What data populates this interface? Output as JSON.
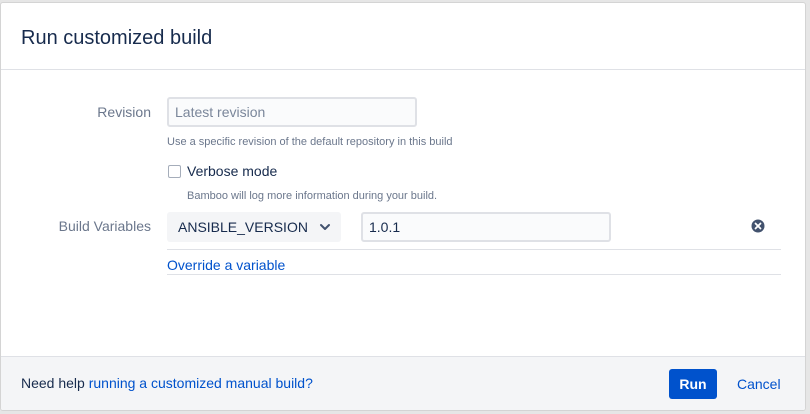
{
  "dialog": {
    "title": "Run customized build"
  },
  "revision": {
    "label": "Revision",
    "placeholder": "Latest revision",
    "help": "Use a specific revision of the default repository in this build"
  },
  "verbose": {
    "label": "Verbose mode",
    "checked": false,
    "help": "Bamboo will log more information during your build."
  },
  "build_variables": {
    "label": "Build Variables",
    "variable_name": "ANSIBLE_VERSION",
    "variable_value": "1.0.1",
    "override_link": "Override a variable",
    "remove_icon": "remove-circle-icon"
  },
  "footer": {
    "help_prefix": "Need help ",
    "help_link": "running a customized manual build?",
    "run_label": "Run",
    "cancel_label": "Cancel"
  },
  "colors": {
    "primary": "#0052cc",
    "text": "#172b4d",
    "muted": "#6b778c"
  }
}
